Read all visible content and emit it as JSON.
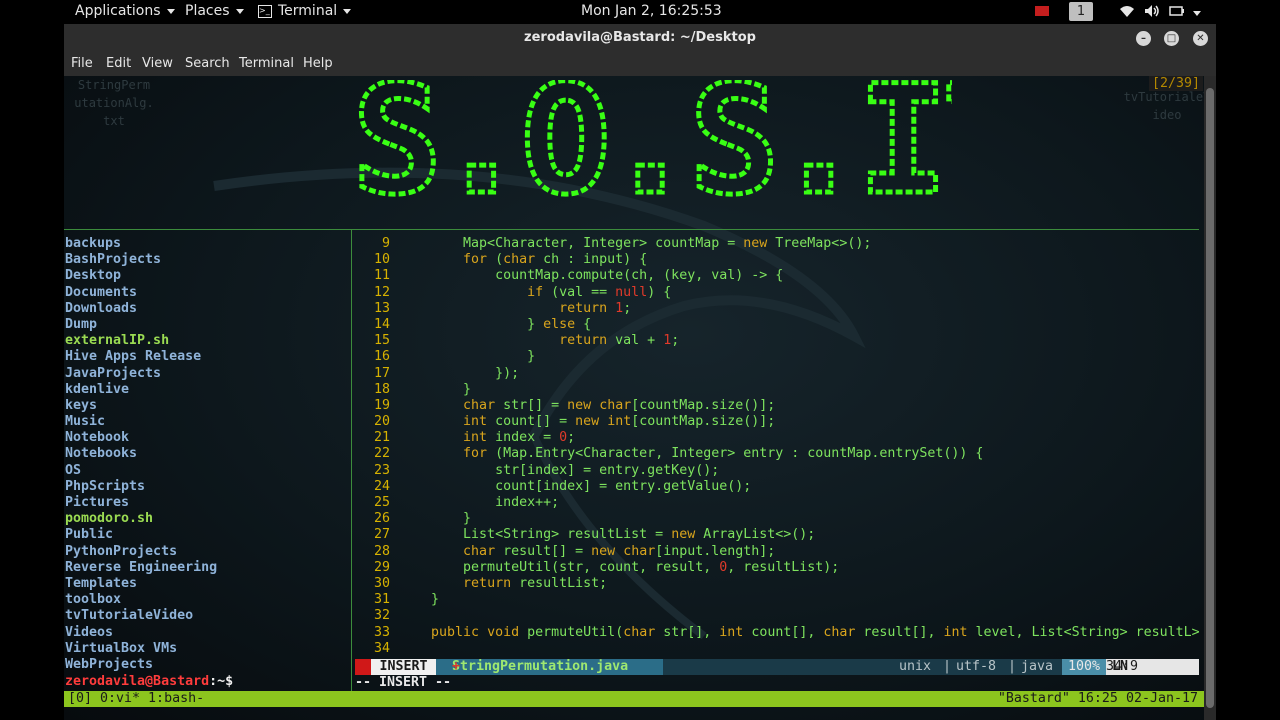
{
  "topbar": {
    "applications": "Applications",
    "places": "Places",
    "terminal": "Terminal",
    "clock": "Mon Jan  2, 16:25:53",
    "workspace": "1"
  },
  "window": {
    "title": "zerodavila@Bastard: ~/Desktop",
    "menu": [
      "File",
      "Edit",
      "View",
      "Search",
      "Terminal",
      "Help"
    ]
  },
  "desktop_ghost": {
    "left": [
      "StringPerm",
      "utationAlg.",
      "txt"
    ],
    "right": [
      "tvTutorialeV",
      "ideo"
    ]
  },
  "pager": "[2/39]",
  "logo_text": "S.O.S.IT",
  "file_list": [
    {
      "name": "backups",
      "type": "dir"
    },
    {
      "name": "BashProjects",
      "type": "dir"
    },
    {
      "name": "Desktop",
      "type": "dir"
    },
    {
      "name": "Documents",
      "type": "dir"
    },
    {
      "name": "Downloads",
      "type": "dir"
    },
    {
      "name": "Dump",
      "type": "dir"
    },
    {
      "name": "externalIP.sh",
      "type": "exe"
    },
    {
      "name": "Hive Apps Release",
      "type": "dir"
    },
    {
      "name": "JavaProjects",
      "type": "dir"
    },
    {
      "name": "kdenlive",
      "type": "dir"
    },
    {
      "name": "keys",
      "type": "dir"
    },
    {
      "name": "Music",
      "type": "dir"
    },
    {
      "name": "Notebook",
      "type": "dir"
    },
    {
      "name": "Notebooks",
      "type": "dir"
    },
    {
      "name": "OS",
      "type": "dir"
    },
    {
      "name": "PhpScripts",
      "type": "dir"
    },
    {
      "name": "Pictures",
      "type": "dir"
    },
    {
      "name": "pomodoro.sh",
      "type": "exe"
    },
    {
      "name": "Public",
      "type": "dir"
    },
    {
      "name": "PythonProjects",
      "type": "dir"
    },
    {
      "name": "Reverse Engineering",
      "type": "dir"
    },
    {
      "name": "Templates",
      "type": "dir"
    },
    {
      "name": "toolbox",
      "type": "dir"
    },
    {
      "name": "tvTutorialeVideo",
      "type": "dir"
    },
    {
      "name": "Videos",
      "type": "dir"
    },
    {
      "name": "VirtualBox VMs",
      "type": "dir"
    },
    {
      "name": "WebProjects",
      "type": "dir"
    }
  ],
  "prompt": {
    "user": "zerodavila@Bastard",
    "path": ":~$"
  },
  "code_lines": [
    {
      "n": "9",
      "t": "        Map<Character, Integer> countMap = new TreeMap<>();"
    },
    {
      "n": "10",
      "t": "        for (char ch : input) {"
    },
    {
      "n": "11",
      "t": "            countMap.compute(ch, (key, val) -> {"
    },
    {
      "n": "12",
      "t": "                if (val == null) {"
    },
    {
      "n": "13",
      "t": "                    return 1;"
    },
    {
      "n": "14",
      "t": "                } else {"
    },
    {
      "n": "15",
      "t": "                    return val + 1;"
    },
    {
      "n": "16",
      "t": "                }"
    },
    {
      "n": "17",
      "t": "            });"
    },
    {
      "n": "18",
      "t": "        }"
    },
    {
      "n": "19",
      "t": "        char str[] = new char[countMap.size()];"
    },
    {
      "n": "20",
      "t": "        int count[] = new int[countMap.size()];"
    },
    {
      "n": "21",
      "t": "        int index = 0;"
    },
    {
      "n": "22",
      "t": "        for (Map.Entry<Character, Integer> entry : countMap.entrySet()) {"
    },
    {
      "n": "23",
      "t": "            str[index] = entry.getKey();"
    },
    {
      "n": "24",
      "t": "            count[index] = entry.getValue();"
    },
    {
      "n": "25",
      "t": "            index++;"
    },
    {
      "n": "26",
      "t": "        }"
    },
    {
      "n": "27",
      "t": "        List<String> resultList = new ArrayList<>();"
    },
    {
      "n": "28",
      "t": "        char result[] = new char[input.length];"
    },
    {
      "n": "29",
      "t": "        permuteUtil(str, count, result, 0, resultList);"
    },
    {
      "n": "30",
      "t": "        return resultList;"
    },
    {
      "n": "31",
      "t": "    }"
    },
    {
      "n": "32",
      "t": ""
    },
    {
      "n": "33",
      "t": "    public void permuteUtil(char str[], int count[], char result[], int level, List<String> resultL>"
    },
    {
      "n": "34",
      "t": ""
    }
  ],
  "vim_status": {
    "mode": "INSERT",
    "filename": "StringPermutation.java",
    "modified": "+",
    "format": "unix",
    "encoding": "utf-8",
    "filetype": "java",
    "percent": "100%",
    "ln_label": "LN",
    "position": "34:9",
    "mode_line": "-- INSERT --"
  },
  "tmux": {
    "windows": "[0] 0:vi* 1:bash-",
    "right": "\"Bastard\" 16:25 02-Jan-17"
  },
  "colors": {
    "logo_green": "#39ff14",
    "code_green": "#7ee35e",
    "keyword": "#d9a51d",
    "number": "#e03a2a",
    "dir_blue": "#8fb3d9",
    "exe_green": "#9adb52",
    "tmux_green": "#8cc51e",
    "vim_status": "#2a6e8a"
  }
}
